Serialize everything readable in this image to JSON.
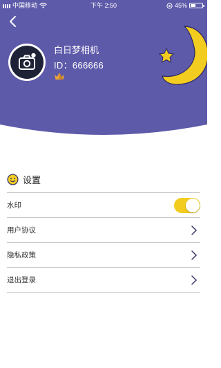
{
  "status_bar": {
    "carrier": "中国移动",
    "time": "下午 2:50",
    "battery": "45%",
    "battery_level": 0.45
  },
  "profile": {
    "name": "白日梦相机",
    "id": "ID：666666"
  },
  "settings": {
    "title": "设置",
    "items": [
      {
        "label": "水印",
        "control": "toggle",
        "on": true
      },
      {
        "label": "用户协议",
        "control": "chevron"
      },
      {
        "label": "隐私政策",
        "control": "chevron"
      },
      {
        "label": "退出登录",
        "control": "chevron"
      }
    ]
  },
  "colors": {
    "header": "#5e5aaa",
    "accent": "#f3cc20",
    "avatar_bg": "#1e2236"
  },
  "icons": {
    "back": "chevron-left-icon",
    "avatar": "camera-icon",
    "badge": "crown-icon",
    "decoration": "moon-star-icon",
    "section": "smiley-icon",
    "row_arrow": "chevron-right-icon"
  }
}
